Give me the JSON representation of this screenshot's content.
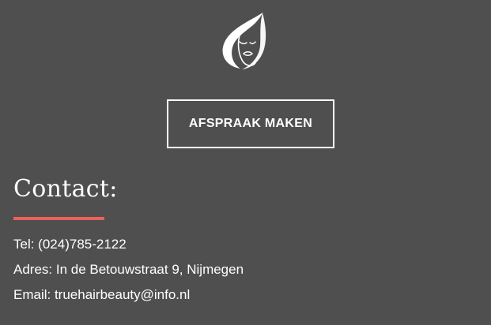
{
  "logo": {
    "icon": "woman-face-flame-logo-icon",
    "color": "#ffffff"
  },
  "cta": {
    "label": "AFSPRAAK MAKEN"
  },
  "contact": {
    "title": "Contact:",
    "accent_color": "#e8645a",
    "phone": "Tel: (024)785-2122",
    "address": "Adres: In de Betouwstraat 9, Nijmegen",
    "email": "Email: truehairbeauty@info.nl"
  },
  "colors": {
    "background": "#4f4f4f",
    "text": "#ffffff"
  }
}
